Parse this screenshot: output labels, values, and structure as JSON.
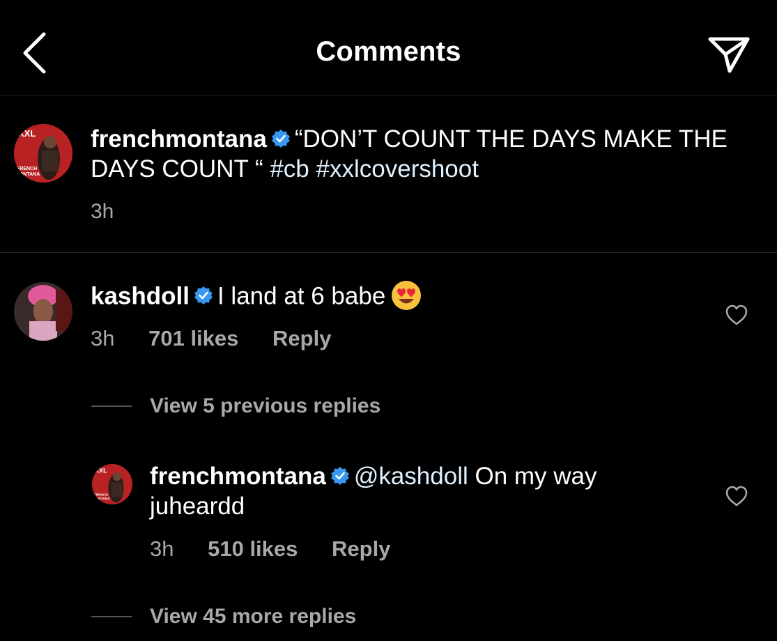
{
  "header": {
    "title": "Comments"
  },
  "caption": {
    "username": "frenchmontana",
    "text": "“DON’T COUNT THE DAYS MAKE THE DAYS COUNT “ ",
    "hashtag1": "#cb",
    "hashtag2": "#xxlcovershoot",
    "time": "3h",
    "avatar_text_top": "XXL",
    "avatar_text_bottom1": "FRENCH",
    "avatar_text_bottom2": "MONTANA"
  },
  "comments": [
    {
      "username": "kashdoll",
      "text": "I land at 6 babe",
      "time": "3h",
      "likes": "701 likes",
      "reply": "Reply",
      "view_replies": "View 5 previous replies"
    }
  ],
  "reply": {
    "username": "frenchmontana",
    "mention": "@kashdoll",
    "text": " On my way juheardd",
    "time": "3h",
    "likes": "510 likes",
    "reply": "Reply",
    "view_more": "View 45 more replies"
  },
  "colors": {
    "background": "#000000",
    "verified": "#3897f0",
    "secondary_text": "#a8a8a8",
    "divider": "#262626"
  },
  "icons": [
    "back-chevron-icon",
    "send-icon",
    "verified-badge-icon",
    "heart-icon",
    "heart-eyes-emoji"
  ]
}
